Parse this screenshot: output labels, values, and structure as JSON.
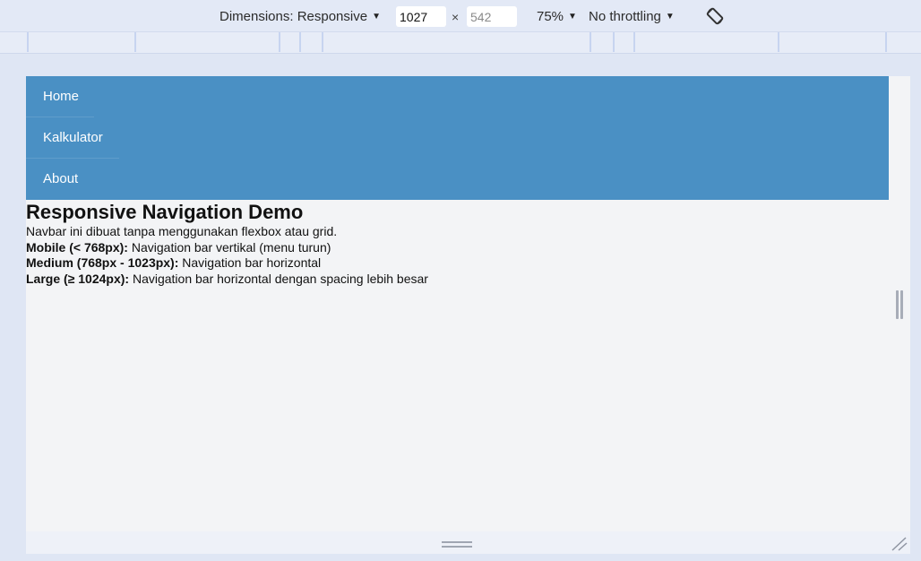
{
  "toolbar": {
    "dimensions_label": "Dimensions: Responsive",
    "width_value": "1027",
    "height_placeholder": "542",
    "times_symbol": "×",
    "zoom_label": "75%",
    "throttling_label": "No throttling",
    "rotate_icon": "rotate-device-icon"
  },
  "page": {
    "nav": {
      "items": [
        {
          "label": "Home"
        },
        {
          "label": "Kalkulator"
        },
        {
          "label": "About"
        }
      ],
      "background": "#4a90c4"
    },
    "title": "Responsive Navigation Demo",
    "intro": "Navbar ini dibuat tanpa menggunakan flexbox atau grid.",
    "breakpoints": [
      {
        "term": "Mobile (< 768px):",
        "desc": " Navigation bar vertikal (menu turun)"
      },
      {
        "term": "Medium (768px - 1023px):",
        "desc": " Navigation bar horizontal"
      },
      {
        "term": "Large (≥ 1024px):",
        "desc": " Navigation bar horizontal dengan spacing lebih besar"
      }
    ]
  }
}
